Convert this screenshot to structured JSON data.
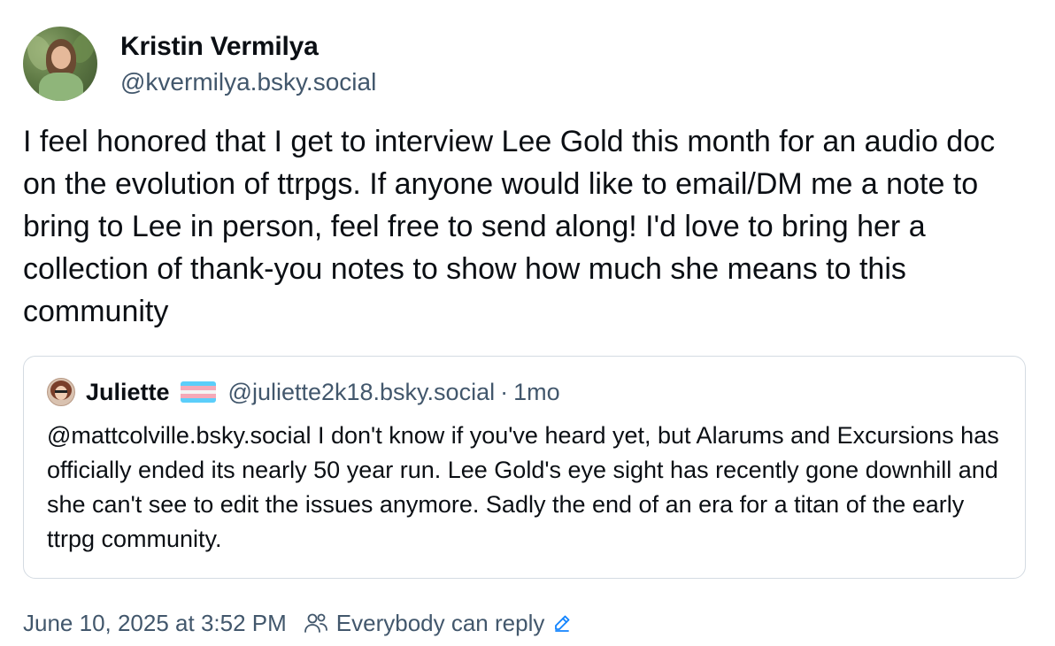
{
  "post": {
    "author": {
      "display_name": "Kristin Vermilya",
      "handle": "@kvermilya.bsky.social"
    },
    "text": "I feel honored that I get to interview Lee Gold this month for an audio doc on the evolution of ttrpgs. If anyone would like to email/DM me a note to bring to Lee in person, feel free to send along! I'd love to bring her a collection of thank-you notes to show how much she means to this community",
    "quote": {
      "author_name": "Juliette",
      "flag_icon": "transgender-flag-icon",
      "flag_colors": [
        "#5bcefa",
        "#f5a9b8",
        "#ffffff",
        "#f5a9b8",
        "#5bcefa"
      ],
      "handle": "@juliette2k18.bsky.social",
      "separator": "·",
      "time": "1mo",
      "text": "@mattcolville.bsky.social I don't know if you've heard yet, but Alarums and Excursions has officially ended its nearly 50 year run. Lee Gold's eye sight has recently gone downhill and she can't see to edit the issues anymore. Sadly the end of an era for a titan of the early ttrpg community."
    },
    "timestamp": "June 10, 2025 at 3:52 PM",
    "reply_setting": "Everybody can reply",
    "icons": {
      "people": "people-icon",
      "edit": "pencil-icon"
    },
    "colors": {
      "text": "#0b0f14",
      "muted": "#42576c",
      "border": "#d4dbe2",
      "accent": "#1083fe"
    }
  }
}
